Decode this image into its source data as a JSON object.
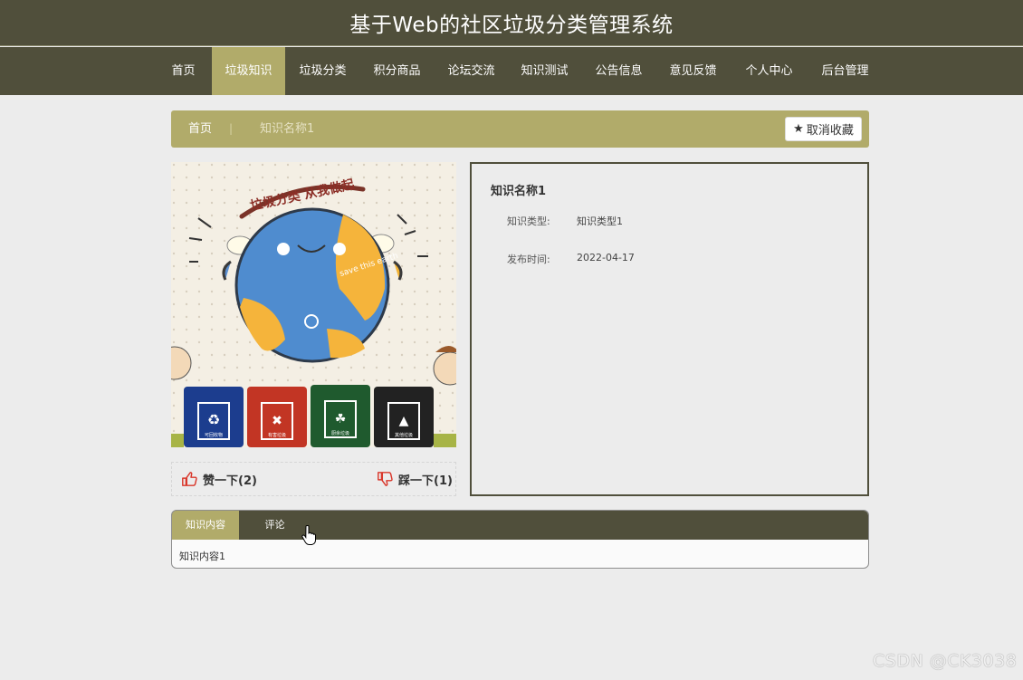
{
  "header": {
    "title": "基于Web的社区垃圾分类管理系统"
  },
  "nav": {
    "items": [
      "首页",
      "垃圾知识",
      "垃圾分类",
      "积分商品",
      "论坛交流",
      "知识测试",
      "公告信息",
      "意见反馈",
      "个人中心",
      "后台管理"
    ],
    "active": "垃圾知识"
  },
  "breadcrumb": {
    "home": "首页",
    "separator": "|",
    "current": "知识名称1",
    "favorite_label": "取消收藏"
  },
  "picture": {
    "banner_text": "垃圾分类 从我做起",
    "globe_text": "save this earth",
    "bins": [
      "可回收物",
      "有害垃圾",
      "厨余垃圾",
      "其他垃圾"
    ]
  },
  "votes": {
    "up_label": "赞一下(2)",
    "down_label": "踩一下(1)"
  },
  "detail": {
    "name": "知识名称1",
    "type_label": "知识类型:",
    "type_value": "知识类型1",
    "time_label": "发布时间:",
    "time_value": "2022-04-17"
  },
  "tabs": {
    "items": [
      "知识内容",
      "评论"
    ],
    "active": "知识内容",
    "content": "知识内容1"
  },
  "watermark": "CSDN @CK3038",
  "colors": {
    "dark": "#504f3b",
    "accent": "#b1ab6a",
    "background": "#ececec"
  }
}
